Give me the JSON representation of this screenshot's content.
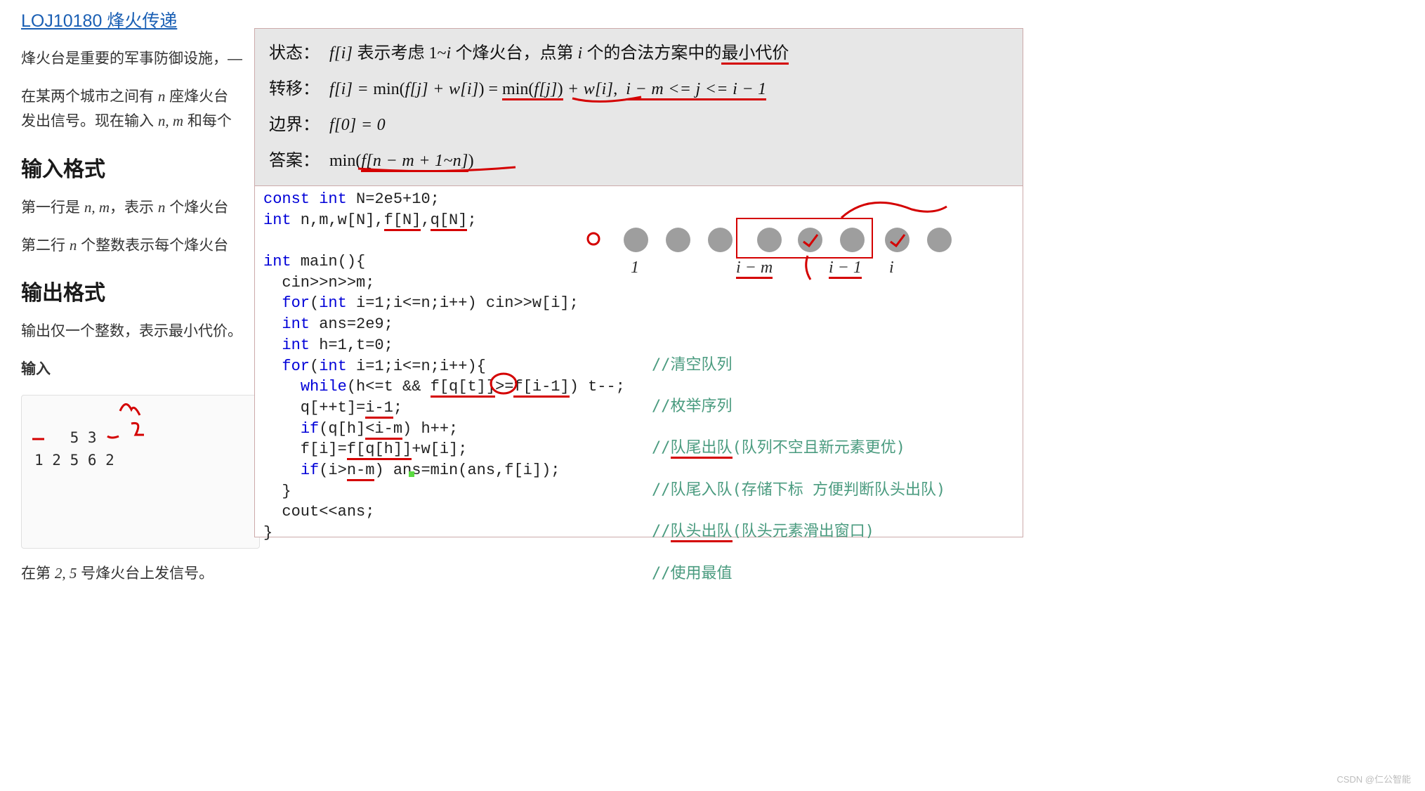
{
  "title": "LOJ10180 烽火传递",
  "problem": {
    "p1": "烽火台是重要的军事防御设施，—",
    "p2a": "在某两个城市之间有 ",
    "p2_var1": "n",
    "p2b": " 座烽火台",
    "p3a": "发出信号。现在输入 ",
    "p3_var": "n, m",
    "p3b": " 和每个"
  },
  "input_format_heading": "输入格式",
  "input_format": {
    "line1a": "第一行是 ",
    "line1_var": "n, m",
    "line1b": "，表示 ",
    "line1_var2": "n",
    "line1c": " 个烽火台",
    "line2a": "第二行 ",
    "line2_var": "n",
    "line2b": " 个整数表示每个烽火台"
  },
  "output_format_heading": "输出格式",
  "output_format_text": "输出仅一个整数，表示最小代价。",
  "input_label": "输入",
  "sample_input": "5 3\n1 2 5 6 2",
  "after_sample_a": "在第 ",
  "after_sample_var": "2, 5",
  "after_sample_b": " 号烽火台上发信号。",
  "gray": {
    "state_label": "状态：",
    "state_expr": "f[i] 表示考虑 1~i 个烽火台，点第 i 个的合法方案中的最小代价",
    "transfer_label": "转移：",
    "transfer_expr": "f[i] = min(f[j] + w[i]) = min(f[j]) + w[i],   i − m <= j <= i − 1",
    "boundary_label": "边界：",
    "boundary_expr": "f[0] = 0",
    "answer_label": "答案：",
    "answer_expr": "min(f[n − m + 1~n])"
  },
  "code": {
    "l1_kw": "const int",
    "l1_rest": " N=2e5+10;",
    "l2_kw": "int",
    "l2_rest": " n,m,w[N],f[N],q[N];",
    "l3": "",
    "l4_kw": "int",
    "l4_rest": " main(){",
    "l5": "  cin>>n>>m;",
    "l6_a": "  ",
    "l6_kw": "for",
    "l6_b": "(",
    "l6_kw2": "int",
    "l6_c": " i=1;i<=n;i++) cin>>w[i];",
    "l7_a": "  ",
    "l7_kw": "int",
    "l7_b": " ans=2e9;",
    "l8_a": "  ",
    "l8_kw": "int",
    "l8_b": " h=1,t=0;",
    "l9_a": "  ",
    "l9_kw": "for",
    "l9_b": "(",
    "l9_kw2": "int",
    "l9_c": " i=1;i<=n;i++){",
    "l10_a": "    ",
    "l10_kw": "while",
    "l10_b": "(h<=t && f[q[t]]>=f[i-1]) t--;",
    "l11": "    q[++t]=i-1;",
    "l12_a": "    ",
    "l12_kw": "if",
    "l12_b": "(q[h]<i-m) h++;",
    "l13": "    f[i]=f[q[h]]+w[i];",
    "l14_a": "    ",
    "l14_kw": "if",
    "l14_b": "(i>n-m) ans=min(ans,f[i]);",
    "l15": "  }",
    "l16": "  cout<<ans;",
    "l17": "}"
  },
  "comments": {
    "c1": "//清空队列",
    "c2": "//枚举序列",
    "c3": "//队尾出队(队列不空且新元素更优)",
    "c4": "//队尾入队(存储下标 方便判断队头出队)",
    "c5": "//队头出队(队头元素滑出窗口)",
    "c6": "//使用最值"
  },
  "diagram": {
    "label1": "1",
    "label_im": "i − m",
    "label_i1": "i − 1",
    "label_i": "i"
  },
  "watermark": "CSDN @仁公智能"
}
